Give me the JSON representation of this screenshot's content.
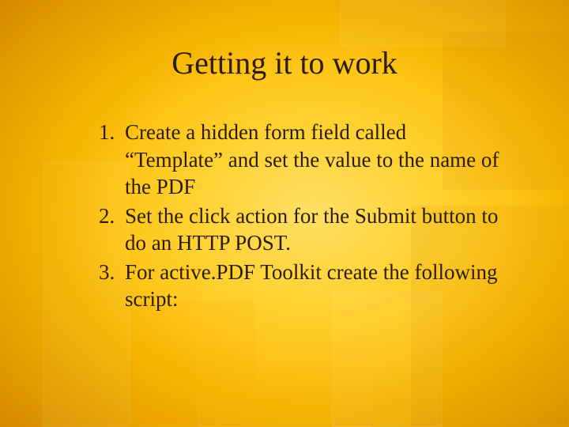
{
  "slide": {
    "title": "Getting it to work",
    "steps": [
      "Create a hidden form field called “Template” and set the value to the name of the PDF",
      "Set the click action for the Submit button to do an HTTP POST.",
      "For active.PDF Toolkit create the following script:"
    ]
  }
}
